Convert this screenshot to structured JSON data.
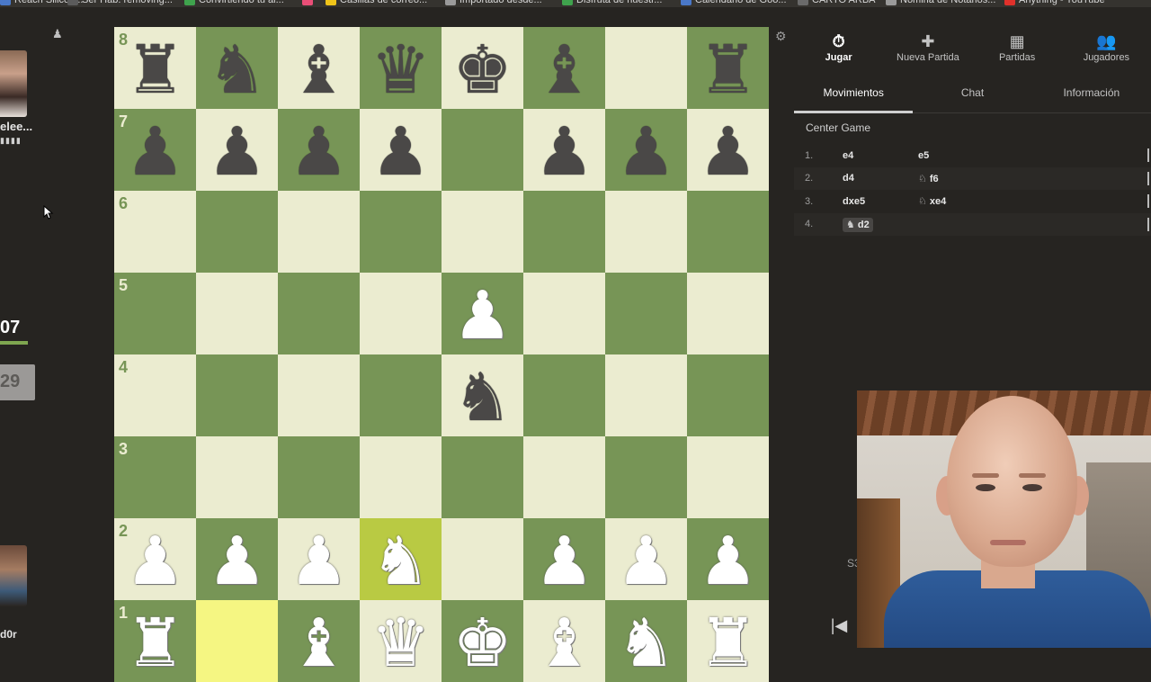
{
  "bookmarks": [
    {
      "label": "Reach Silicon...",
      "color": "#4a78c8"
    },
    {
      "label": "Ser Hab. removing...",
      "color": "#5b5b5b"
    },
    {
      "label": "Convirtiendo tu ai...",
      "color": "#3fa34d"
    },
    {
      "label": "",
      "color": "#e94e77"
    },
    {
      "label": "Casillas de correo...",
      "color": "#f0c419"
    },
    {
      "label": "Importado desde...",
      "color": "#9a9a9a"
    },
    {
      "label": "Disfruta de nuestr...",
      "color": "#3fa34d"
    },
    {
      "label": "Calendario de Goo...",
      "color": "#4a78c8"
    },
    {
      "label": "CARTO ARBA",
      "color": "#6a6a6a"
    },
    {
      "label": "Nómina de Notarios...",
      "color": "#9a9a9a"
    },
    {
      "label": "Anything - YouTube",
      "color": "#e0312b"
    }
  ],
  "left": {
    "pawn_glyph": "♟",
    "opponent_name": "elee...",
    "opponent_flair": "▮▮▮▮",
    "clock_top": "07",
    "clock_bottom": "29",
    "player_name": "d0r"
  },
  "board": {
    "ranks": [
      "8",
      "7",
      "6",
      "5",
      "4",
      "3",
      "2",
      "1"
    ],
    "squares": [
      [
        {
          "p": "♜",
          "c": "b"
        },
        {
          "p": "♞",
          "c": "b"
        },
        {
          "p": "♝",
          "c": "b"
        },
        {
          "p": "♛",
          "c": "b"
        },
        {
          "p": "♚",
          "c": "b"
        },
        {
          "p": "♝",
          "c": "b"
        },
        {
          "p": "",
          "c": ""
        },
        {
          "p": "♜",
          "c": "b"
        }
      ],
      [
        {
          "p": "♟",
          "c": "b"
        },
        {
          "p": "♟",
          "c": "b"
        },
        {
          "p": "♟",
          "c": "b"
        },
        {
          "p": "♟",
          "c": "b"
        },
        {
          "p": "",
          "c": ""
        },
        {
          "p": "♟",
          "c": "b"
        },
        {
          "p": "♟",
          "c": "b"
        },
        {
          "p": "♟",
          "c": "b"
        }
      ],
      [
        {
          "p": "",
          "c": ""
        },
        {
          "p": "",
          "c": ""
        },
        {
          "p": "",
          "c": ""
        },
        {
          "p": "",
          "c": ""
        },
        {
          "p": "",
          "c": ""
        },
        {
          "p": "",
          "c": ""
        },
        {
          "p": "",
          "c": ""
        },
        {
          "p": "",
          "c": ""
        }
      ],
      [
        {
          "p": "",
          "c": ""
        },
        {
          "p": "",
          "c": ""
        },
        {
          "p": "",
          "c": ""
        },
        {
          "p": "",
          "c": ""
        },
        {
          "p": "♟",
          "c": "w"
        },
        {
          "p": "",
          "c": ""
        },
        {
          "p": "",
          "c": ""
        },
        {
          "p": "",
          "c": ""
        }
      ],
      [
        {
          "p": "",
          "c": ""
        },
        {
          "p": "",
          "c": ""
        },
        {
          "p": "",
          "c": ""
        },
        {
          "p": "",
          "c": ""
        },
        {
          "p": "♞",
          "c": "b"
        },
        {
          "p": "",
          "c": ""
        },
        {
          "p": "",
          "c": ""
        },
        {
          "p": "",
          "c": ""
        }
      ],
      [
        {
          "p": "",
          "c": ""
        },
        {
          "p": "",
          "c": ""
        },
        {
          "p": "",
          "c": ""
        },
        {
          "p": "",
          "c": ""
        },
        {
          "p": "",
          "c": ""
        },
        {
          "p": "",
          "c": ""
        },
        {
          "p": "",
          "c": ""
        },
        {
          "p": "",
          "c": ""
        }
      ],
      [
        {
          "p": "♟",
          "c": "w"
        },
        {
          "p": "♟",
          "c": "w"
        },
        {
          "p": "♟",
          "c": "w"
        },
        {
          "p": "♞",
          "c": "w",
          "hl": true
        },
        {
          "p": "",
          "c": ""
        },
        {
          "p": "♟",
          "c": "w"
        },
        {
          "p": "♟",
          "c": "w"
        },
        {
          "p": "♟",
          "c": "w"
        }
      ],
      [
        {
          "p": "♜",
          "c": "w"
        },
        {
          "p": "",
          "c": "",
          "hl": true
        },
        {
          "p": "♝",
          "c": "w"
        },
        {
          "p": "♛",
          "c": "w"
        },
        {
          "p": "♚",
          "c": "w"
        },
        {
          "p": "♝",
          "c": "w"
        },
        {
          "p": "♞",
          "c": "w"
        },
        {
          "p": "♜",
          "c": "w"
        }
      ]
    ],
    "colors": {
      "light": "#ebecd0",
      "dark": "#779556",
      "highlight": "#b9ca43"
    }
  },
  "nav": [
    {
      "label": "Jugar",
      "glyph": "⏱",
      "active": true
    },
    {
      "label": "Nueva Partida",
      "glyph": "✚",
      "active": false
    },
    {
      "label": "Partidas",
      "glyph": "▦",
      "active": false
    },
    {
      "label": "Jugadores",
      "glyph": "👥",
      "active": false
    }
  ],
  "tabs": [
    {
      "label": "Movimientos",
      "active": true
    },
    {
      "label": "Chat",
      "active": false
    },
    {
      "label": "Información",
      "active": false
    }
  ],
  "opening": "Center Game",
  "moves": [
    {
      "num": "1.",
      "white": "e4",
      "black": "e5",
      "white_fig": "",
      "black_fig": "",
      "selected": false
    },
    {
      "num": "2.",
      "white": "d4",
      "black": "f6",
      "white_fig": "",
      "black_fig": "♘",
      "selected": false
    },
    {
      "num": "3.",
      "white": "dxe5",
      "black": "xe4",
      "white_fig": "",
      "black_fig": "♘",
      "selected": false
    },
    {
      "num": "4.",
      "white": "d2",
      "black": "",
      "white_fig": "♞",
      "black_fig": "",
      "selected": true
    }
  ],
  "controls": {
    "first": "|◀",
    "s3": "S3"
  }
}
